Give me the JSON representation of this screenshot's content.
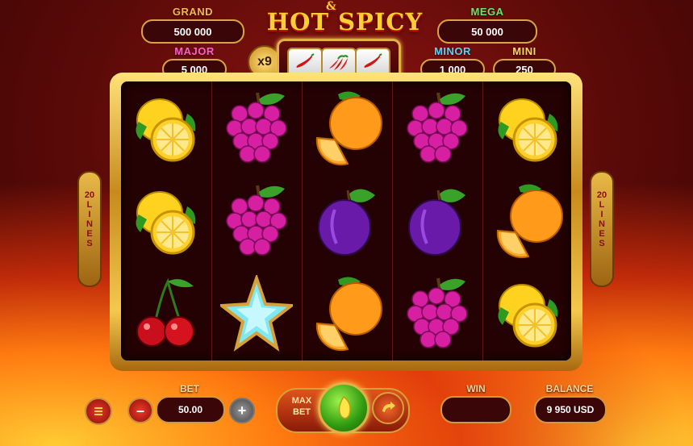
{
  "game": {
    "title_amp": "&",
    "title": "HOT SPICY"
  },
  "jackpots": {
    "grand": {
      "label": "GRAND",
      "value": "500 000",
      "color": "#f0b94a"
    },
    "major": {
      "label": "MAJOR",
      "value": "5 000",
      "color": "#ff5ccf"
    },
    "mega": {
      "label": "MEGA",
      "value": "50 000",
      "color": "#6fe06a"
    },
    "minor": {
      "label": "MINOR",
      "value": "1 000",
      "color": "#4fd6ff"
    },
    "mini": {
      "label": "MINI",
      "value": "250",
      "color": "#ffd56a"
    }
  },
  "multiplier": "x9",
  "pepper_icons": [
    "pepper-icon",
    "pepper-cluster-icon",
    "pepper-icon"
  ],
  "lines_label": "20\nL\nI\nN\nE\nS",
  "reels": [
    [
      "lemon",
      "lemon",
      "cherry"
    ],
    [
      "grapes",
      "grapes",
      "star"
    ],
    [
      "orange",
      "plum",
      "orange"
    ],
    [
      "grapes",
      "plum",
      "grapes"
    ],
    [
      "lemon",
      "orange",
      "lemon"
    ]
  ],
  "controls": {
    "menu_icon": "menu-icon",
    "minus": "–",
    "plus": "+",
    "bet_label": "BET",
    "bet_value": "50.00",
    "max_bet": "MAX\nBET",
    "win_label": "WIN",
    "win_value": "",
    "balance_label": "BALANCE",
    "balance_value": "9 950 USD"
  },
  "colors": {
    "accent_gold": "#e1b048",
    "background": "#5a0a08"
  }
}
